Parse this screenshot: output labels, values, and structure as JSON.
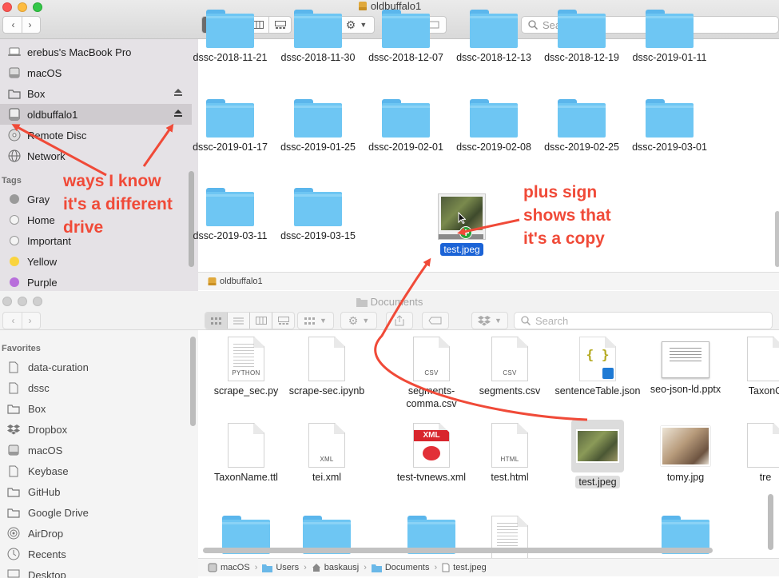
{
  "top_window": {
    "title": "oldbuffalo1",
    "search": {
      "placeholder": "Search"
    },
    "sidebar": {
      "devices": [
        {
          "label": "erebus's MacBook Pro",
          "icon": "laptop-icon",
          "eject": false
        },
        {
          "label": "macOS",
          "icon": "drive-icon",
          "eject": false
        },
        {
          "label": "Box",
          "icon": "folder-icon",
          "eject": true
        },
        {
          "label": "oldbuffalo1",
          "icon": "drive-icon",
          "eject": true,
          "selected": true
        },
        {
          "label": "Remote Disc",
          "icon": "disc-icon",
          "eject": false
        },
        {
          "label": "Network",
          "icon": "globe-icon",
          "eject": false
        }
      ],
      "tags_header": "Tags",
      "tags": [
        {
          "label": "Gray",
          "color": "#9a9a9a"
        },
        {
          "label": "Home",
          "color": "#f4f4f4"
        },
        {
          "label": "Important",
          "color": "#f4f4f4"
        },
        {
          "label": "Yellow",
          "color": "#fad43e"
        },
        {
          "label": "Purple",
          "color": "#b86fdb"
        }
      ]
    },
    "files": [
      "dssc-2018-11-21",
      "dssc-2018-11-30",
      "dssc-2018-12-07",
      "dssc-2018-12-13",
      "dssc-2018-12-19",
      "dssc-2019-01-11",
      "dssc-2019-01-17",
      "dssc-2019-01-25",
      "dssc-2019-02-01",
      "dssc-2019-02-08",
      "dssc-2019-02-25",
      "dssc-2019-03-01",
      "dssc-2019-03-11",
      "dssc-2019-03-15"
    ],
    "dragged_file": "test.jpeg",
    "pathbar": "oldbuffalo1"
  },
  "bottom_window": {
    "title": "Documents",
    "search": {
      "placeholder": "Search"
    },
    "sidebar": {
      "favorites_header": "Favorites",
      "items": [
        {
          "label": "data-curation",
          "icon": "document-icon"
        },
        {
          "label": "dssc",
          "icon": "document-icon"
        },
        {
          "label": "Box",
          "icon": "folder-icon"
        },
        {
          "label": "Dropbox",
          "icon": "dropbox-icon"
        },
        {
          "label": "macOS",
          "icon": "drive-icon"
        },
        {
          "label": "Keybase",
          "icon": "document-icon"
        },
        {
          "label": "GitHub",
          "icon": "folder-icon"
        },
        {
          "label": "Google Drive",
          "icon": "folder-icon"
        },
        {
          "label": "AirDrop",
          "icon": "airdrop-icon"
        },
        {
          "label": "Recents",
          "icon": "clock-icon"
        },
        {
          "label": "Desktop",
          "icon": "desktop-icon"
        }
      ]
    },
    "files_row1": [
      {
        "label": "scrape_sec.py",
        "ext": "PYTHON",
        "kind": "code"
      },
      {
        "label": "scrape-sec.ipynb",
        "ext": "",
        "kind": "blank"
      },
      {
        "label": "segments-comma.csv",
        "ext": "CSV",
        "kind": "doc"
      },
      {
        "label": "segments.csv",
        "ext": "CSV",
        "kind": "doc"
      },
      {
        "label": "sentenceTable.json",
        "ext": "{ }",
        "kind": "json"
      },
      {
        "label": "seo-json-ld.pptx",
        "ext": "",
        "kind": "slide"
      },
      {
        "label": "TaxonC",
        "ext": "",
        "kind": "blank"
      }
    ],
    "files_row2": [
      {
        "label": "TaxonName.ttl",
        "ext": "",
        "kind": "blank"
      },
      {
        "label": "tei.xml",
        "ext": "XML",
        "kind": "doc"
      },
      {
        "label": "test-tvnews.xml",
        "ext": "XML",
        "kind": "xmlred"
      },
      {
        "label": "test.html",
        "ext": "HTML",
        "kind": "doc"
      },
      {
        "label": "test.jpeg",
        "ext": "",
        "kind": "photo"
      },
      {
        "label": "tomy.jpg",
        "ext": "",
        "kind": "photo2"
      },
      {
        "label": "tre",
        "ext": "",
        "kind": "blank"
      }
    ],
    "pathbar": [
      "macOS",
      "Users",
      "baskausj",
      "Documents",
      "test.jpeg"
    ]
  },
  "annotations": {
    "left_note": [
      "ways I know",
      "it's a different",
      "drive"
    ],
    "right_note": [
      "plus sign",
      "shows that",
      "it's a copy"
    ],
    "color": "#f04a38"
  }
}
